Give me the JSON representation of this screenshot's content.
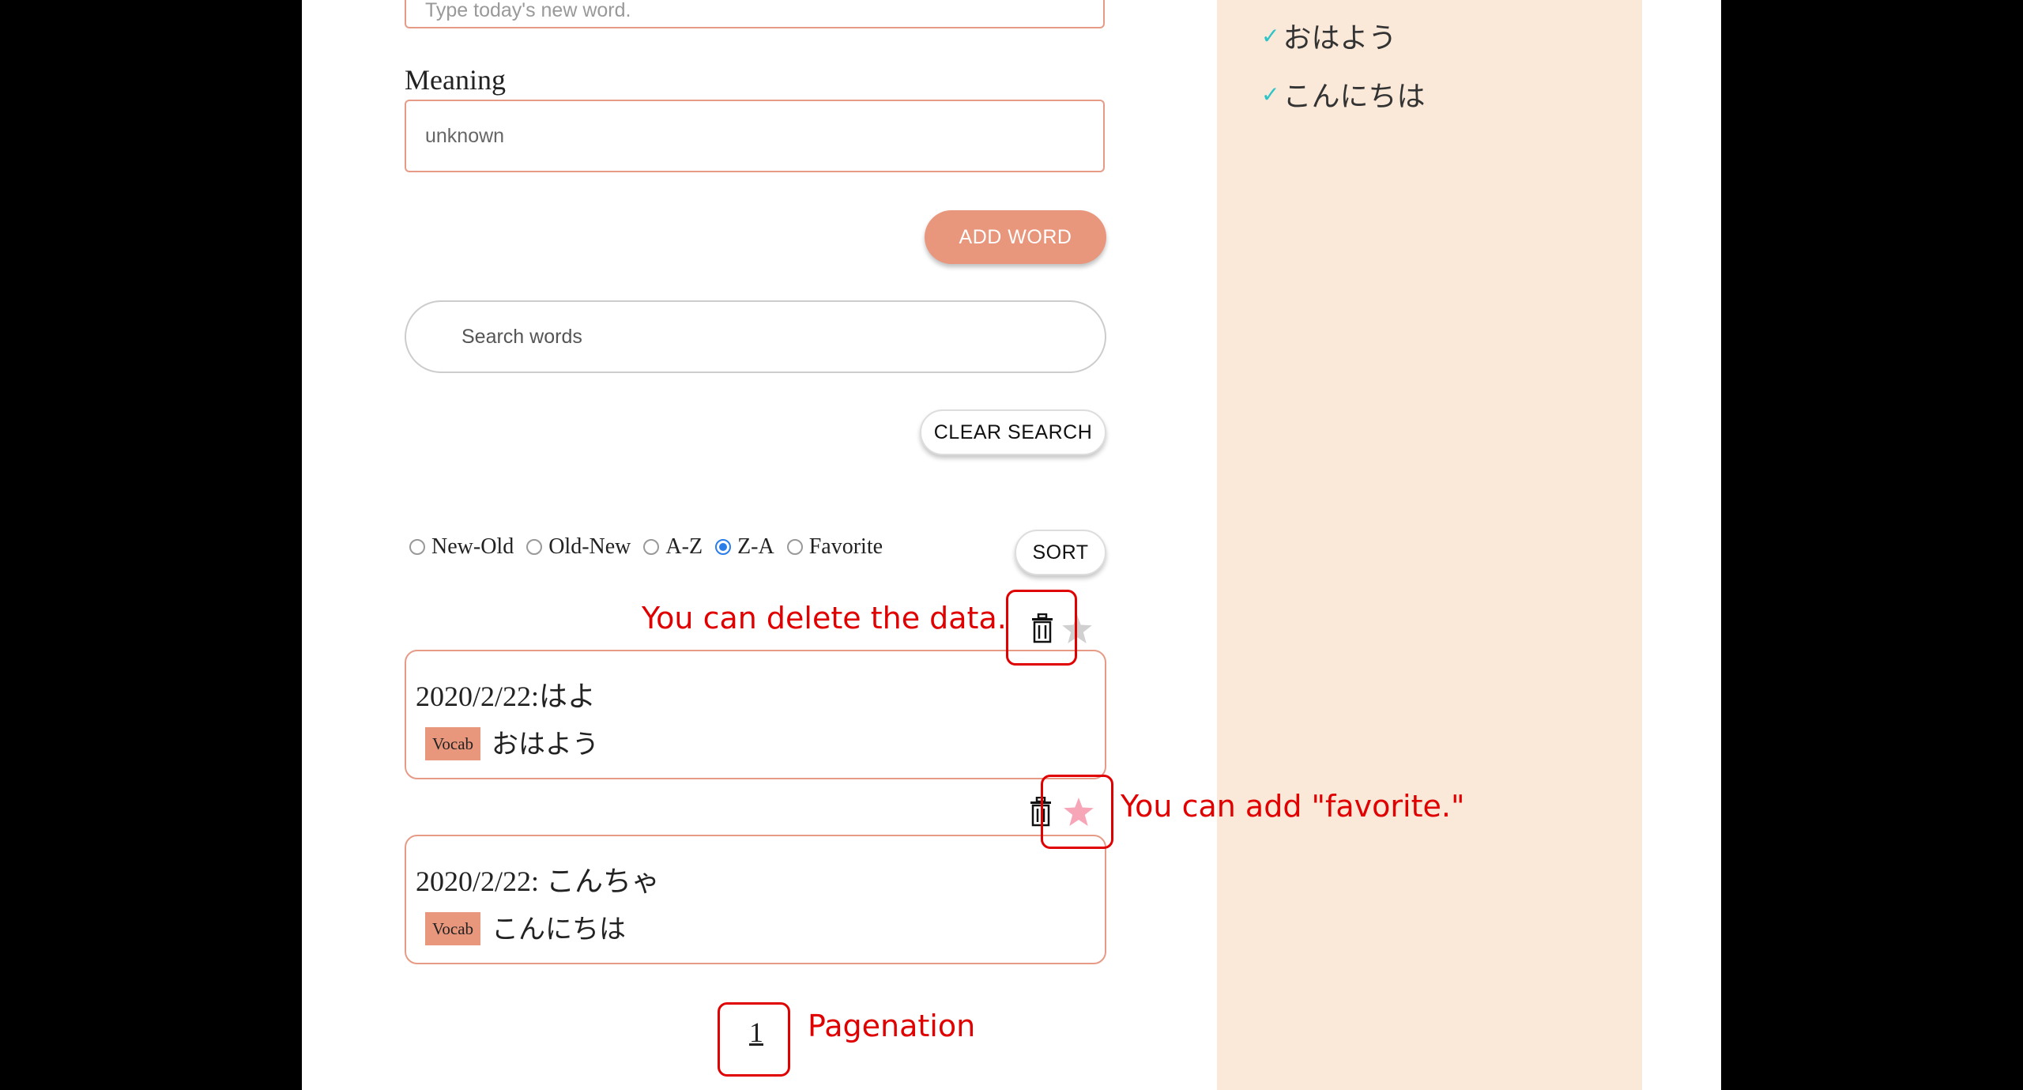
{
  "form": {
    "word_placeholder": "Type today's new word.",
    "meaning_label": "Meaning",
    "meaning_value": "unknown",
    "add_word_label": "ADD WORD",
    "search_placeholder": "Search words",
    "clear_search_label": "CLEAR SEARCH"
  },
  "sort": {
    "options": [
      "New-Old",
      "Old-New",
      "A-Z",
      "Z-A",
      "Favorite"
    ],
    "selected": "Z-A",
    "button_label": "SORT"
  },
  "cards": [
    {
      "title": "2020/2/22:はよ",
      "tag": "Vocab",
      "word": "おはよう",
      "favorite": false
    },
    {
      "title": "2020/2/22: こんちゃ",
      "tag": "Vocab",
      "word": "こんにちは",
      "favorite": true
    }
  ],
  "sidebar": {
    "items": [
      {
        "icon": "check-icon",
        "label": "おはよう"
      },
      {
        "icon": "check-icon",
        "label": "こんにちは"
      }
    ]
  },
  "pagination": {
    "current_page": "1"
  },
  "annotations": {
    "delete": "You can delete the data.",
    "favorite": "You can add \"favorite.\"",
    "pagination": "Pagenation"
  },
  "colors": {
    "accent": "#e8967c",
    "border": "#e79b86",
    "sidebar_bg": "#fae9d9",
    "annotation_red": "#e00000",
    "favorite_star": "#f7a6b8",
    "inactive_star": "#d0d0d0",
    "check_teal": "#2cc3c9",
    "radio_blue": "#2b7de9"
  }
}
